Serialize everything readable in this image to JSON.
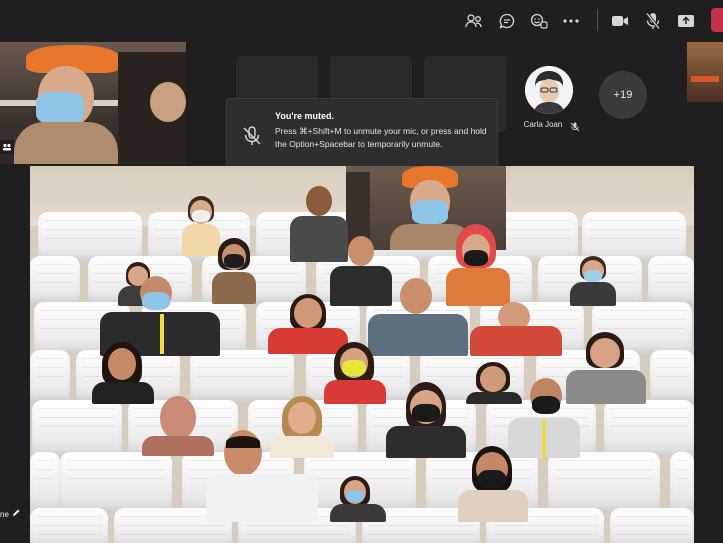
{
  "toolbar": {
    "icons": [
      "people-icon",
      "chat-icon",
      "reactions-icon",
      "more-options-icon",
      "camera-icon",
      "mic-muted-icon",
      "share-screen-icon"
    ],
    "leave_color": "#c4314b"
  },
  "toast": {
    "title": "You're muted.",
    "body": "Press ⌘+Shift+M to unmute your mic, or press and hold the Option+Spacebar to temporarily unmute."
  },
  "participants": {
    "carla": {
      "name": "Carla Joan"
    },
    "overflow": {
      "label": "+19"
    }
  },
  "self": {
    "name_fragment": "ne"
  },
  "colors": {
    "background": "#1f1f1f",
    "accent_orange": "#e8772e",
    "mask_blue": "#8ec5e6"
  }
}
